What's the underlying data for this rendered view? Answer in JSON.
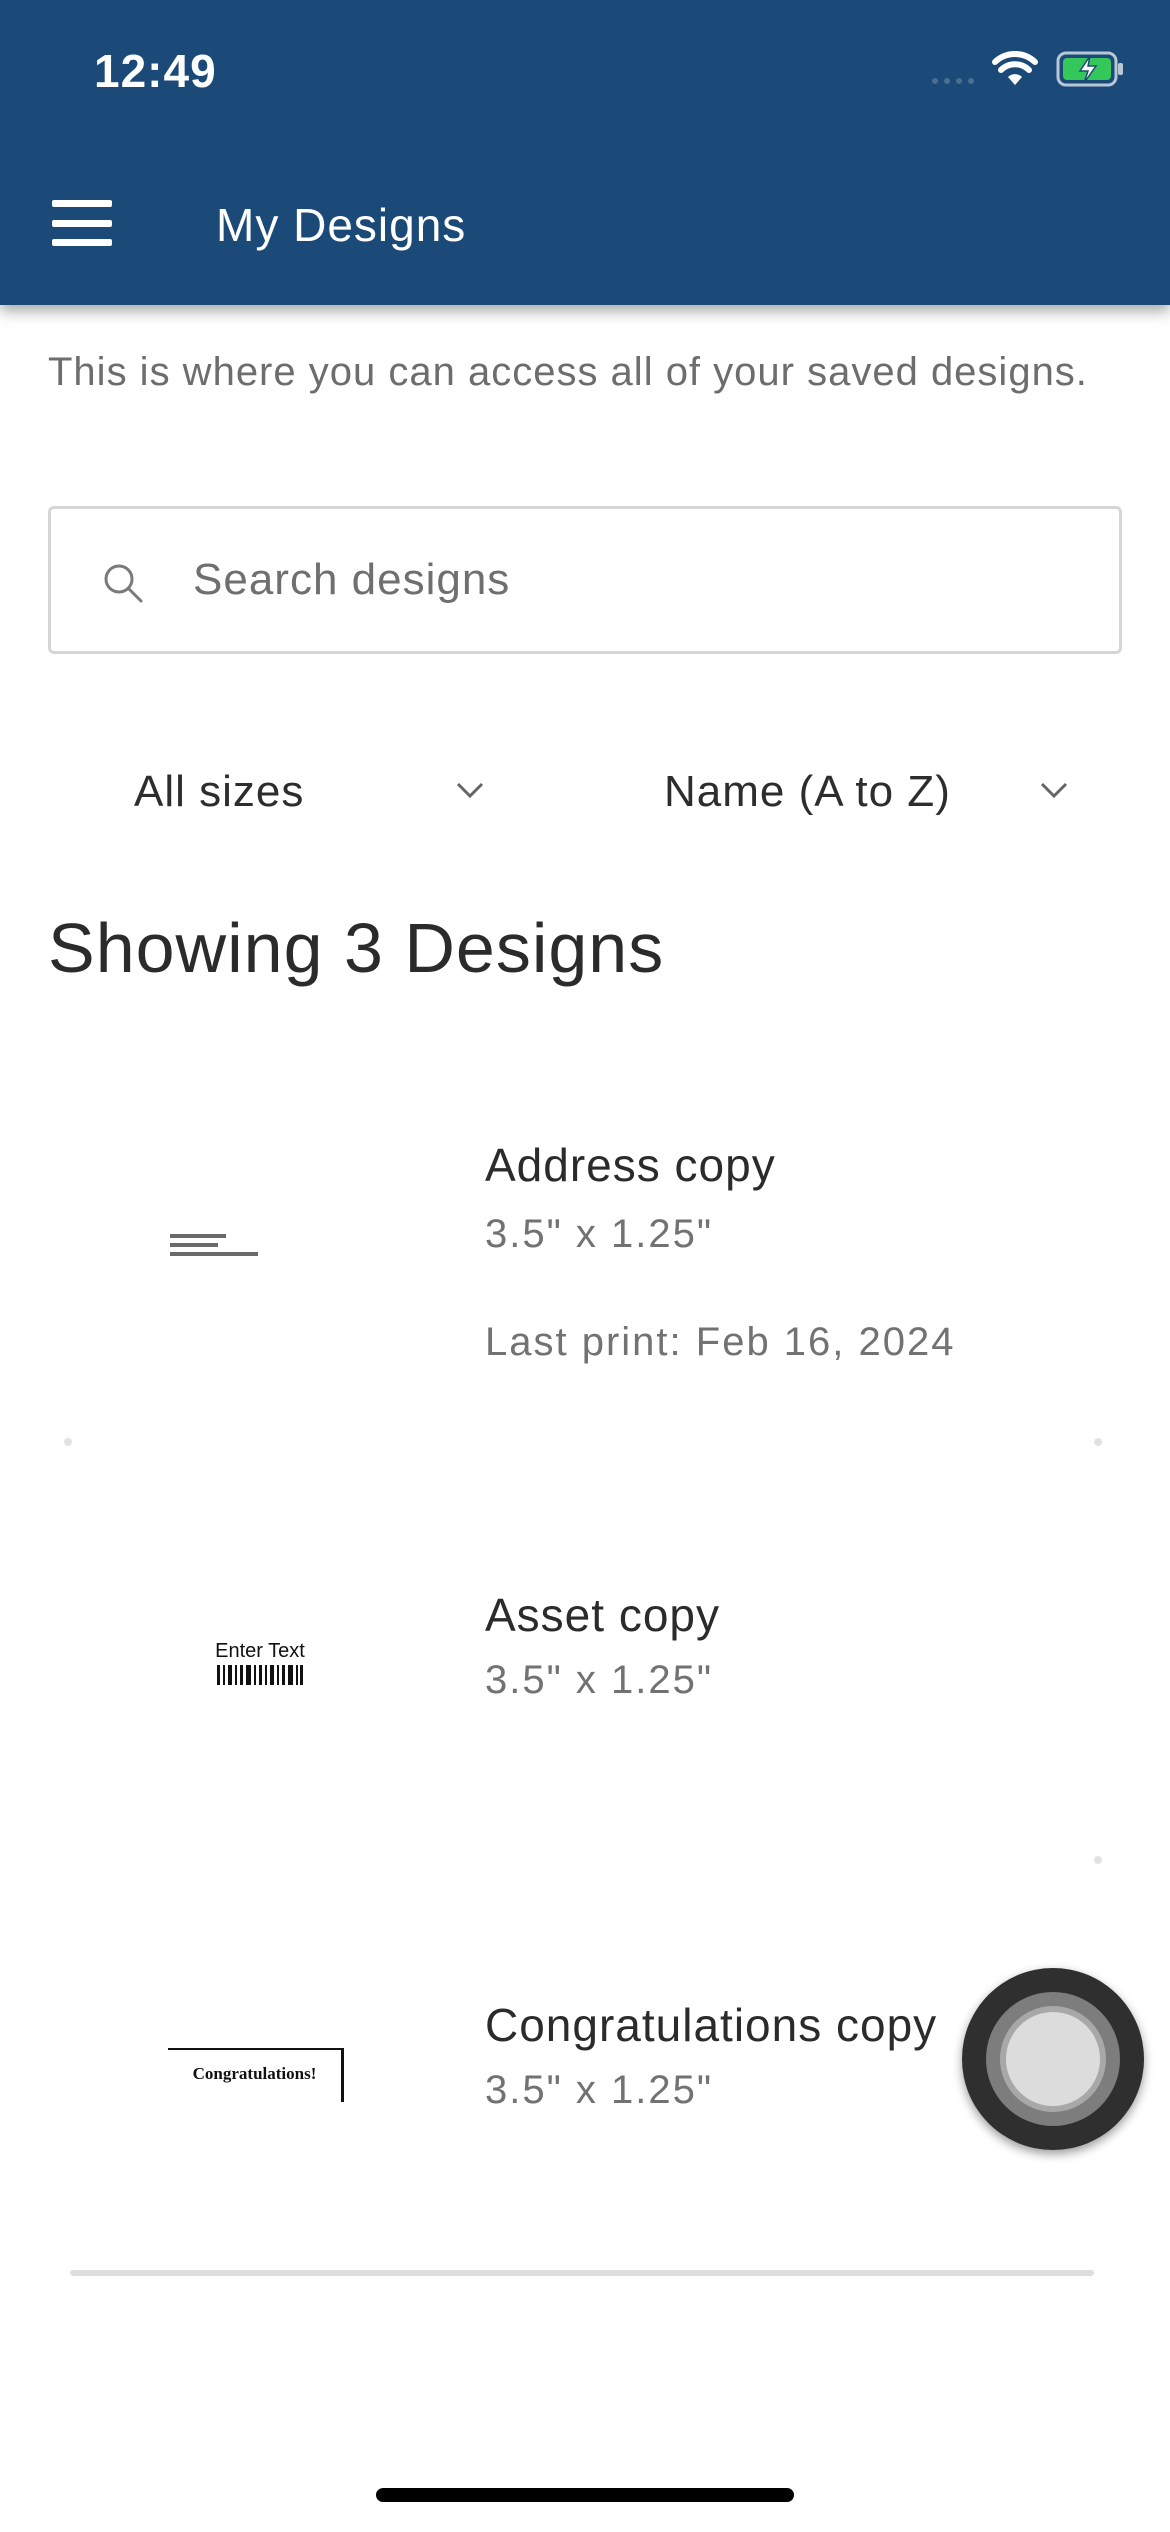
{
  "status_bar": {
    "time": "12:49"
  },
  "header": {
    "title": "My Designs"
  },
  "subtitle": "This is where you can access all of your saved designs.",
  "search": {
    "placeholder": "Search designs"
  },
  "filters": {
    "size": "All sizes",
    "sort": "Name (A to Z)"
  },
  "results_heading": "Showing 3 Designs",
  "designs": [
    {
      "name": "Address copy",
      "size": "3.5\" x 1.25\"",
      "last_print": "Last print: Feb 16, 2024"
    },
    {
      "name": "Asset copy",
      "size": "3.5\" x 1.25\"",
      "thumb_text": "Enter Text"
    },
    {
      "name": "Congratulations copy",
      "size": "3.5\" x 1.25\"",
      "thumb_text": "Congratulations!"
    }
  ],
  "colors": {
    "appbar": "#1b4a78",
    "battery": "#34c759"
  }
}
